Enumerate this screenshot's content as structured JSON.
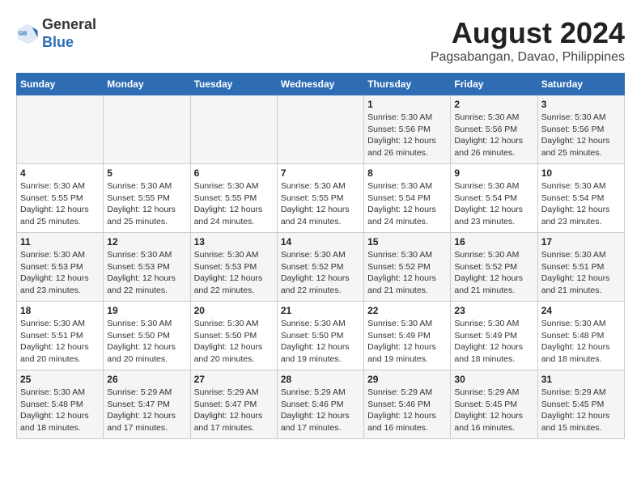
{
  "header": {
    "logo_line1": "General",
    "logo_line2": "Blue",
    "title": "August 2024",
    "subtitle": "Pagsabangan, Davao, Philippines"
  },
  "calendar": {
    "weekdays": [
      "Sunday",
      "Monday",
      "Tuesday",
      "Wednesday",
      "Thursday",
      "Friday",
      "Saturday"
    ],
    "weeks": [
      [
        {
          "day": "",
          "info": ""
        },
        {
          "day": "",
          "info": ""
        },
        {
          "day": "",
          "info": ""
        },
        {
          "day": "",
          "info": ""
        },
        {
          "day": "1",
          "info": "Sunrise: 5:30 AM\nSunset: 5:56 PM\nDaylight: 12 hours\nand 26 minutes."
        },
        {
          "day": "2",
          "info": "Sunrise: 5:30 AM\nSunset: 5:56 PM\nDaylight: 12 hours\nand 26 minutes."
        },
        {
          "day": "3",
          "info": "Sunrise: 5:30 AM\nSunset: 5:56 PM\nDaylight: 12 hours\nand 25 minutes."
        }
      ],
      [
        {
          "day": "4",
          "info": "Sunrise: 5:30 AM\nSunset: 5:55 PM\nDaylight: 12 hours\nand 25 minutes."
        },
        {
          "day": "5",
          "info": "Sunrise: 5:30 AM\nSunset: 5:55 PM\nDaylight: 12 hours\nand 25 minutes."
        },
        {
          "day": "6",
          "info": "Sunrise: 5:30 AM\nSunset: 5:55 PM\nDaylight: 12 hours\nand 24 minutes."
        },
        {
          "day": "7",
          "info": "Sunrise: 5:30 AM\nSunset: 5:55 PM\nDaylight: 12 hours\nand 24 minutes."
        },
        {
          "day": "8",
          "info": "Sunrise: 5:30 AM\nSunset: 5:54 PM\nDaylight: 12 hours\nand 24 minutes."
        },
        {
          "day": "9",
          "info": "Sunrise: 5:30 AM\nSunset: 5:54 PM\nDaylight: 12 hours\nand 23 minutes."
        },
        {
          "day": "10",
          "info": "Sunrise: 5:30 AM\nSunset: 5:54 PM\nDaylight: 12 hours\nand 23 minutes."
        }
      ],
      [
        {
          "day": "11",
          "info": "Sunrise: 5:30 AM\nSunset: 5:53 PM\nDaylight: 12 hours\nand 23 minutes."
        },
        {
          "day": "12",
          "info": "Sunrise: 5:30 AM\nSunset: 5:53 PM\nDaylight: 12 hours\nand 22 minutes."
        },
        {
          "day": "13",
          "info": "Sunrise: 5:30 AM\nSunset: 5:53 PM\nDaylight: 12 hours\nand 22 minutes."
        },
        {
          "day": "14",
          "info": "Sunrise: 5:30 AM\nSunset: 5:52 PM\nDaylight: 12 hours\nand 22 minutes."
        },
        {
          "day": "15",
          "info": "Sunrise: 5:30 AM\nSunset: 5:52 PM\nDaylight: 12 hours\nand 21 minutes."
        },
        {
          "day": "16",
          "info": "Sunrise: 5:30 AM\nSunset: 5:52 PM\nDaylight: 12 hours\nand 21 minutes."
        },
        {
          "day": "17",
          "info": "Sunrise: 5:30 AM\nSunset: 5:51 PM\nDaylight: 12 hours\nand 21 minutes."
        }
      ],
      [
        {
          "day": "18",
          "info": "Sunrise: 5:30 AM\nSunset: 5:51 PM\nDaylight: 12 hours\nand 20 minutes."
        },
        {
          "day": "19",
          "info": "Sunrise: 5:30 AM\nSunset: 5:50 PM\nDaylight: 12 hours\nand 20 minutes."
        },
        {
          "day": "20",
          "info": "Sunrise: 5:30 AM\nSunset: 5:50 PM\nDaylight: 12 hours\nand 20 minutes."
        },
        {
          "day": "21",
          "info": "Sunrise: 5:30 AM\nSunset: 5:50 PM\nDaylight: 12 hours\nand 19 minutes."
        },
        {
          "day": "22",
          "info": "Sunrise: 5:30 AM\nSunset: 5:49 PM\nDaylight: 12 hours\nand 19 minutes."
        },
        {
          "day": "23",
          "info": "Sunrise: 5:30 AM\nSunset: 5:49 PM\nDaylight: 12 hours\nand 18 minutes."
        },
        {
          "day": "24",
          "info": "Sunrise: 5:30 AM\nSunset: 5:48 PM\nDaylight: 12 hours\nand 18 minutes."
        }
      ],
      [
        {
          "day": "25",
          "info": "Sunrise: 5:30 AM\nSunset: 5:48 PM\nDaylight: 12 hours\nand 18 minutes."
        },
        {
          "day": "26",
          "info": "Sunrise: 5:29 AM\nSunset: 5:47 PM\nDaylight: 12 hours\nand 17 minutes."
        },
        {
          "day": "27",
          "info": "Sunrise: 5:29 AM\nSunset: 5:47 PM\nDaylight: 12 hours\nand 17 minutes."
        },
        {
          "day": "28",
          "info": "Sunrise: 5:29 AM\nSunset: 5:46 PM\nDaylight: 12 hours\nand 17 minutes."
        },
        {
          "day": "29",
          "info": "Sunrise: 5:29 AM\nSunset: 5:46 PM\nDaylight: 12 hours\nand 16 minutes."
        },
        {
          "day": "30",
          "info": "Sunrise: 5:29 AM\nSunset: 5:45 PM\nDaylight: 12 hours\nand 16 minutes."
        },
        {
          "day": "31",
          "info": "Sunrise: 5:29 AM\nSunset: 5:45 PM\nDaylight: 12 hours\nand 15 minutes."
        }
      ]
    ]
  }
}
